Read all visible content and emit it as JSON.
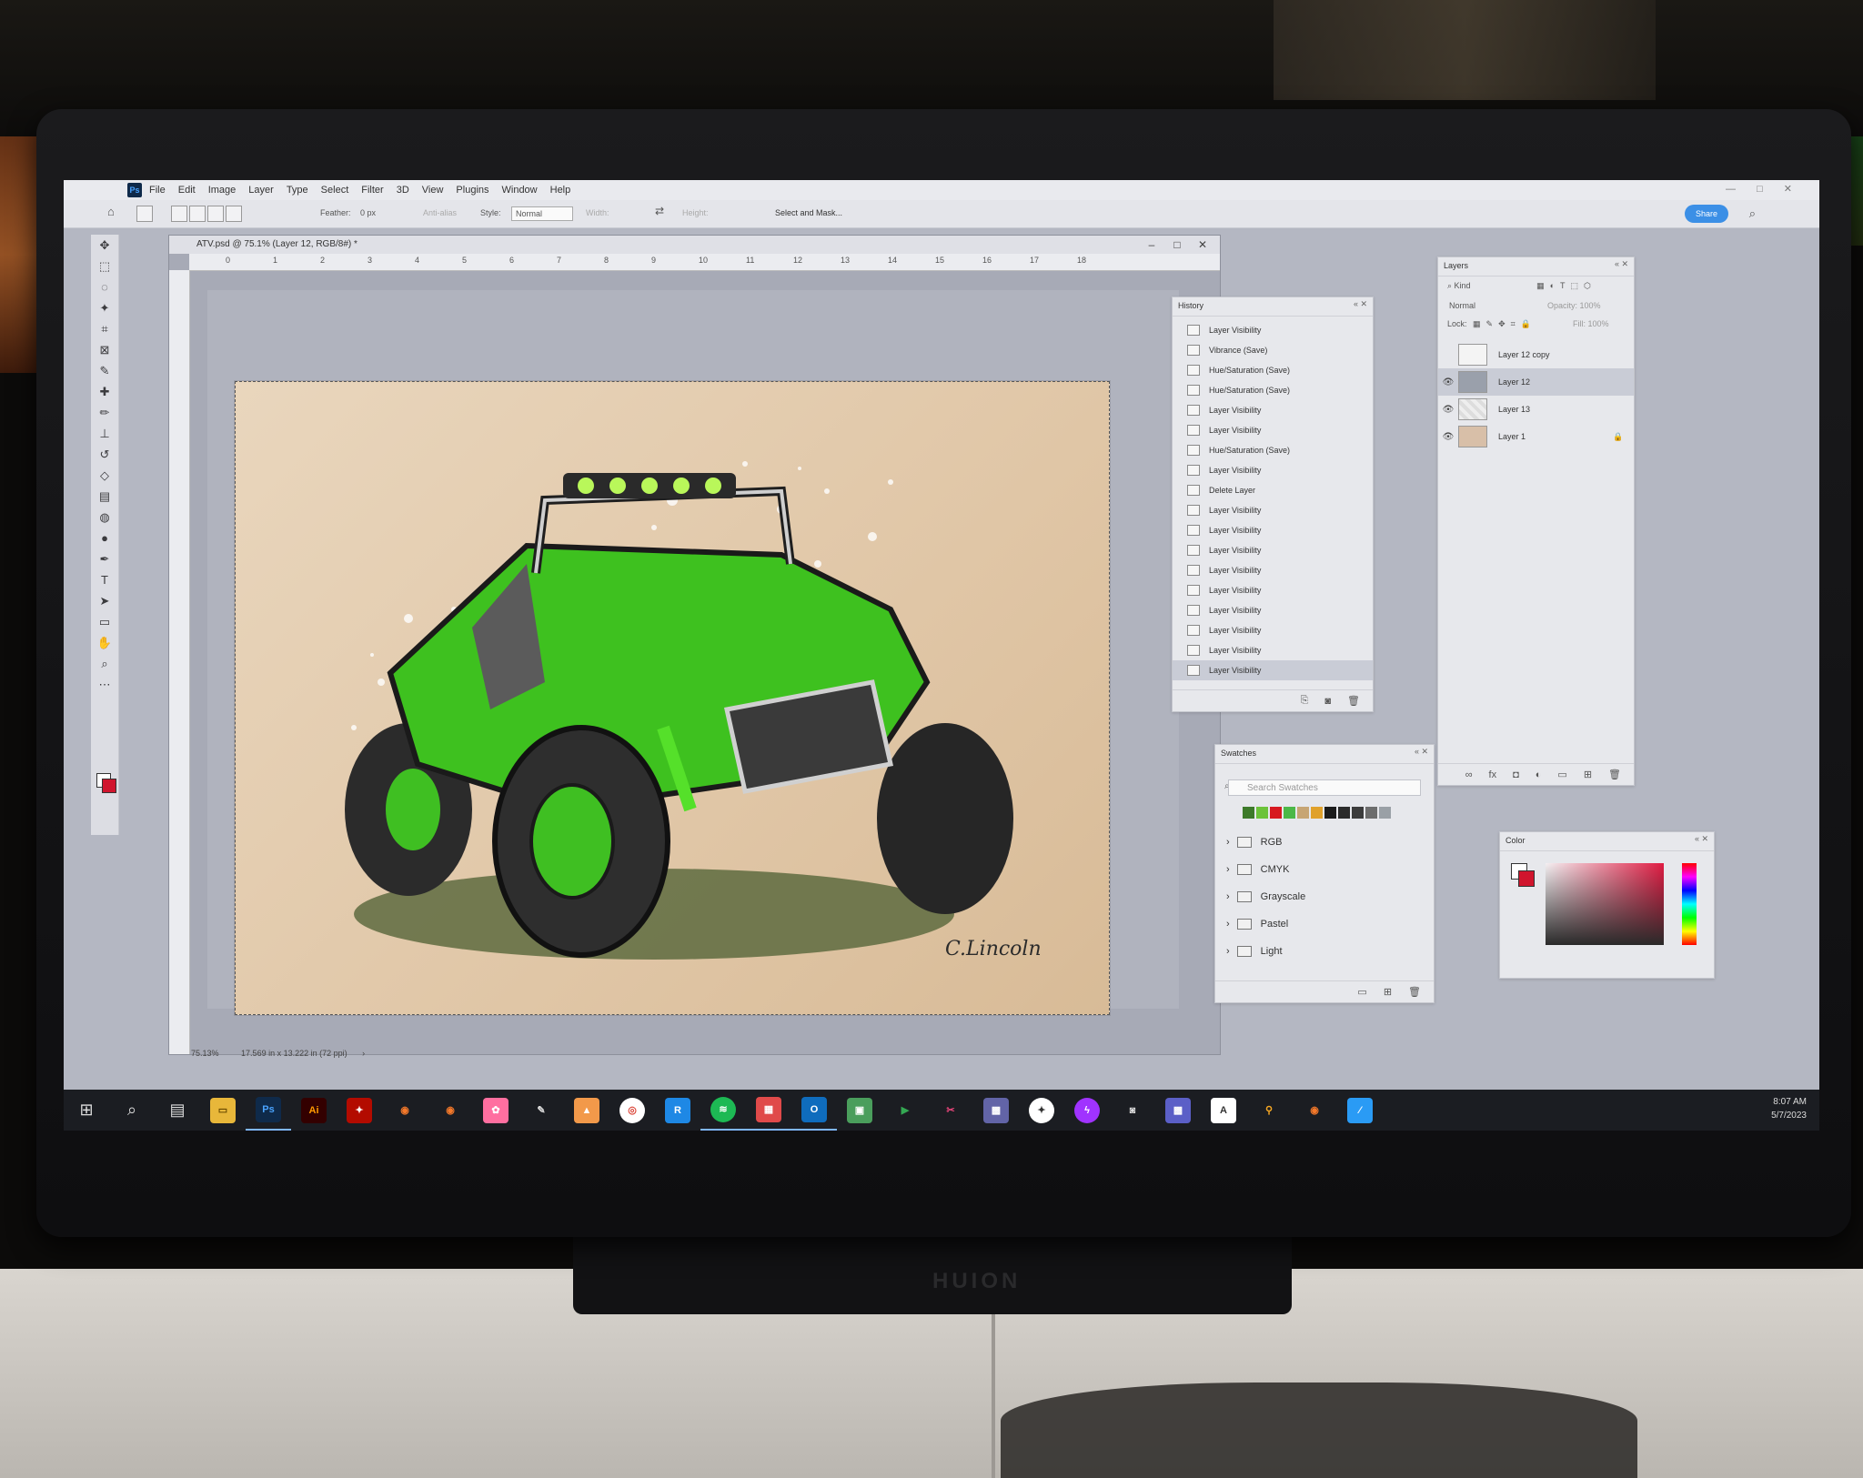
{
  "menubar": {
    "items": [
      "File",
      "Edit",
      "Image",
      "Layer",
      "Type",
      "Select",
      "Filter",
      "3D",
      "View",
      "Plugins",
      "Window",
      "Help"
    ]
  },
  "options": {
    "feather_label": "Feather:",
    "feather_value": "0 px",
    "antialias": "Anti-alias",
    "style_label": "Style:",
    "style_value": "Normal",
    "width_label": "Width:",
    "height_label": "Height:",
    "select_mask": "Select and Mask...",
    "share": "Share"
  },
  "document": {
    "tab": "ATV.psd @ 75.1% (Layer 12, RGB/8#) *",
    "ruler_marks": [
      "0",
      "1",
      "2",
      "3",
      "4",
      "5",
      "6",
      "7",
      "8",
      "9",
      "10",
      "11",
      "12",
      "13",
      "14",
      "15",
      "16",
      "17",
      "18"
    ],
    "zoom": "75.13%",
    "size": "17.569 in x 13.222 in (72 ppi)",
    "signature": "C.Lincoln"
  },
  "history": {
    "title": "History",
    "items": [
      "Layer Visibility",
      "Vibrance (Save)",
      "Hue/Saturation (Save)",
      "Hue/Saturation (Save)",
      "Layer Visibility",
      "Layer Visibility",
      "Hue/Saturation (Save)",
      "Layer Visibility",
      "Delete Layer",
      "Layer Visibility",
      "Layer Visibility",
      "Layer Visibility",
      "Layer Visibility",
      "Layer Visibility",
      "Layer Visibility",
      "Layer Visibility",
      "Layer Visibility",
      "Layer Visibility"
    ]
  },
  "layers": {
    "title": "Layers",
    "kind_label": "Kind",
    "blend_mode": "Normal",
    "opacity_label": "Opacity:",
    "opacity_value": "100%",
    "lock_label": "Lock:",
    "fill_label": "Fill:",
    "fill_value": "100%",
    "items": [
      {
        "name": "Layer 12 copy",
        "visible": false,
        "selected": false
      },
      {
        "name": "Layer 12",
        "visible": true,
        "selected": true
      },
      {
        "name": "Layer 13",
        "visible": true,
        "selected": false
      },
      {
        "name": "Layer 1",
        "visible": true,
        "selected": false
      }
    ]
  },
  "swatches": {
    "title": "Swatches",
    "search_placeholder": "Search Swatches",
    "colors": [
      "#3d7a2a",
      "#6cc33a",
      "#d71920",
      "#4cb848",
      "#c7a574",
      "#e0a12b",
      "#1b1b1b",
      "#2b2b2b",
      "#3c3c3c",
      "#6d6d6d",
      "#9aa0a6"
    ],
    "groups": [
      "RGB",
      "CMYK",
      "Grayscale",
      "Pastel",
      "Light"
    ]
  },
  "color_panel": {
    "title": "Color",
    "fg": "#ffffff",
    "bg": "#d0152d"
  },
  "taskbar": {
    "time": "8:07 AM",
    "date": "5/7/2023"
  },
  "brand": "HUION"
}
